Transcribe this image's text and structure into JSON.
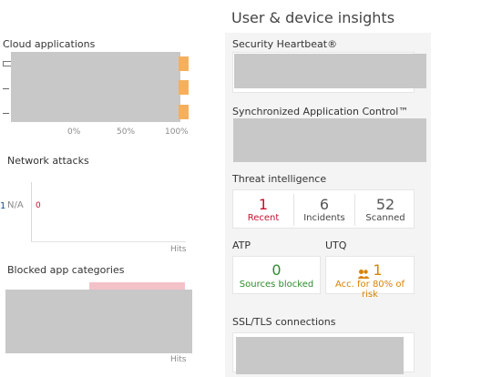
{
  "header": {
    "title": "User & device insights"
  },
  "left": {
    "cloud_apps": {
      "title": "Cloud applications",
      "ticks": [
        "0%",
        "50%",
        "100%"
      ]
    },
    "network_attacks": {
      "title": "Network attacks",
      "na_label": "N/A",
      "value": "0",
      "axis_label": "Hits"
    },
    "blocked_apps": {
      "title": "Blocked app categories",
      "axis_label": "Hits"
    }
  },
  "right": {
    "heartbeat": {
      "title": "Security Heartbeat®"
    },
    "sync_app_control": {
      "title": "Synchronized Application Control™"
    },
    "threat_intel": {
      "title": "Threat intelligence",
      "stats": [
        {
          "value": "1",
          "label": "Recent"
        },
        {
          "value": "6",
          "label": "Incidents"
        },
        {
          "value": "52",
          "label": "Scanned"
        }
      ]
    },
    "atp": {
      "title": "ATP",
      "value": "0",
      "label": "Sources blocked"
    },
    "utq": {
      "title": "UTQ",
      "value": "1",
      "label": "Acc. for 80% of risk"
    },
    "ssl": {
      "title": "SSL/TLS connections"
    }
  },
  "colors": {
    "red": "#c8102e",
    "green": "#2e8b2e",
    "orange": "#d88200",
    "bar_orange": "#f6b05c",
    "pink": "#f3c2c8"
  }
}
